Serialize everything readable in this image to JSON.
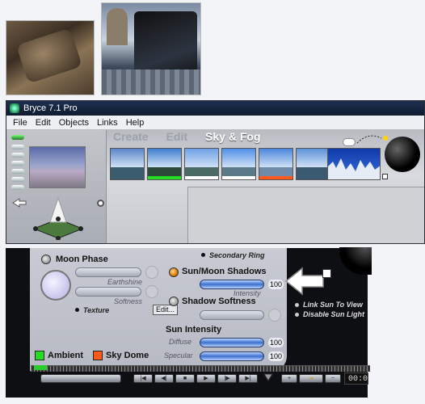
{
  "window": {
    "title": "Bryce 7.1  Pro"
  },
  "menu": [
    "File",
    "Edit",
    "Objects",
    "Links",
    "Help"
  ],
  "tabs": {
    "create": "Create",
    "edit": "Edit",
    "active": "Sky & Fog"
  },
  "presets": [
    {
      "sky": "#5a86c8",
      "ground": "#3a5c6e",
      "bar": ""
    },
    {
      "sky": "#3f7fd0",
      "ground": "#2c4a3a",
      "bar": "#22dd22"
    },
    {
      "sky": "#6ea0e6",
      "ground": "#4a6a66",
      "bar": "#ffffff"
    },
    {
      "sky": "#4f8fe8",
      "ground": "#5a7a8a",
      "bar": "#ffffff"
    },
    {
      "sky": "#4a86dc",
      "ground": "#6e8aa8",
      "bar": "#ff5a1a"
    },
    {
      "sky": "#5c92d8",
      "ground": "#3a5a72",
      "bar": ""
    }
  ],
  "sunmoon": {
    "moon_phase": "Moon Phase",
    "secondary_ring": "Secondary Ring",
    "earthshine": "Earthshine",
    "softness": "Softness",
    "texture": "Texture",
    "edit": "Edit...",
    "sun_moon_shadows": "Sun/Moon Shadows",
    "intensity": "Intensity",
    "intensity_value": "100",
    "shadow_softness": "Shadow Softness",
    "sun_intensity": "Sun Intensity",
    "diffuse": "Diffuse",
    "diffuse_value": "100",
    "specular": "Specular",
    "specular_value": "100",
    "link_sun": "Link Sun To View",
    "disable_sun": "Disable Sun Light",
    "ambient": "Ambient",
    "sky_dome": "Sky Dome",
    "ambient_color": "#22dd22",
    "sky_dome_color": "#ff5a1a"
  },
  "time_display": "00:0"
}
